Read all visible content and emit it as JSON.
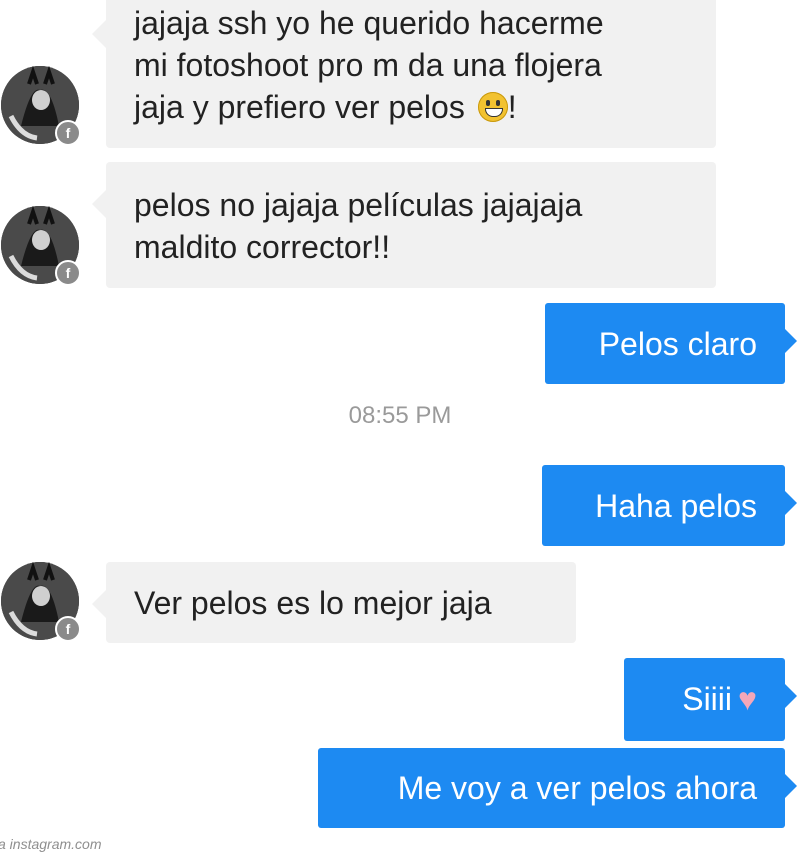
{
  "conversation": {
    "messages": [
      {
        "from": "them",
        "lines": [
          "jajaja ssh yo he querido hacerme",
          "mi fotoshoot pro m da una flojera",
          "jaja y prefiero ver pelos"
        ],
        "trailing": "!",
        "emoji": "grinning-face-emoji"
      },
      {
        "from": "them",
        "lines": [
          "pelos no jajaja películas jajajaja",
          "maldito corrector!!"
        ]
      },
      {
        "from": "me",
        "text": "Pelos claro"
      },
      {
        "from": "me",
        "text": "Haha pelos"
      },
      {
        "from": "them",
        "text": "Ver pelos es lo mejor jaja"
      },
      {
        "from": "me",
        "text": "Siiii",
        "emoji": "heart-emoji"
      },
      {
        "from": "me",
        "text": "Me voy a ver pelos ahora"
      }
    ],
    "timestamp": "08:55 PM"
  },
  "avatar": {
    "badge": "f",
    "badge_icon": "facebook-icon"
  },
  "watermark": "a instagram.com",
  "colors": {
    "incoming_bubble": "#f1f1f1",
    "outgoing_bubble": "#1d8af2",
    "timestamp": "#9a9a9a"
  }
}
